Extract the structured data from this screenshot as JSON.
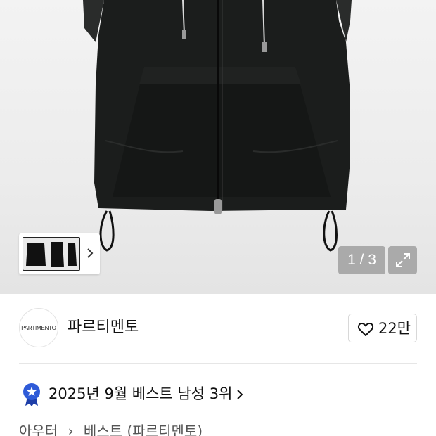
{
  "gallery": {
    "counter": "1 / 3",
    "thumbnail_count": 3
  },
  "brand": {
    "logo_text": "PARTIMENTO",
    "name": "파르티멘토",
    "likes": "22만"
  },
  "ranking": {
    "text": "2025년 9월 베스트 남성 3위"
  },
  "breadcrumb": {
    "items": [
      "아우터",
      "베스트 (파르티멘토)"
    ]
  },
  "colors": {
    "accent_badge": "#2f5bd8",
    "text_primary": "#111111",
    "counter_bg": "#969696"
  },
  "icons": {
    "like": "heart-outline-icon",
    "expand": "expand-arrows-icon",
    "thumb_next": "chevron-right-icon",
    "rank": "medal-badge-icon",
    "rank_more": "chevron-right-icon"
  }
}
